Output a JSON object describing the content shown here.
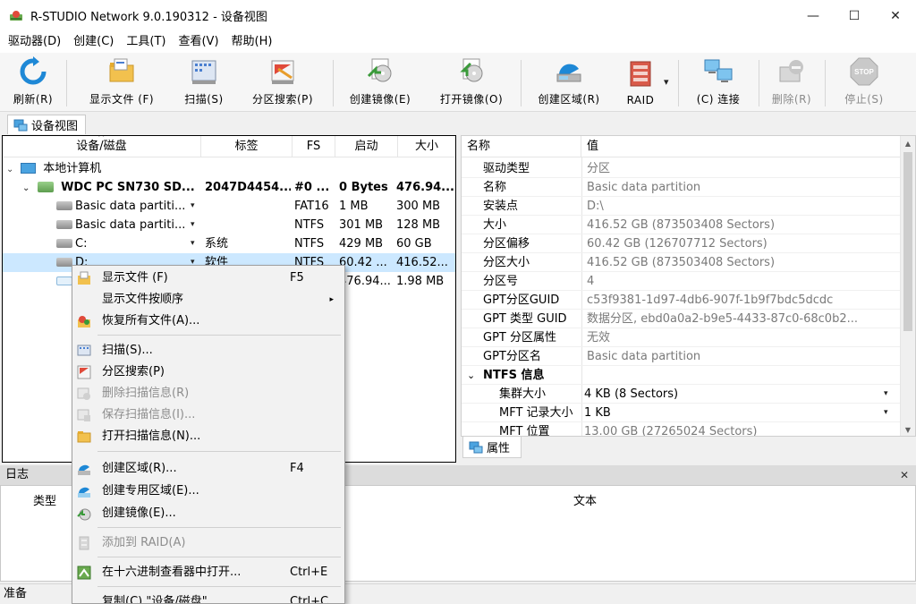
{
  "window": {
    "title": "R-STUDIO Network 9.0.190312 - 设备视图",
    "min_glyph": "—",
    "max_glyph": "☐",
    "close_glyph": "✕"
  },
  "menu": [
    "驱动器(D)",
    "创建(C)",
    "工具(T)",
    "查看(V)",
    "帮助(H)"
  ],
  "toolbar": {
    "refresh": "刷新(R)",
    "show_files": "显示文件 (F)",
    "scan": "扫描(S)",
    "partition_search": "分区搜索(P)",
    "create_image": "创建镜像(E)",
    "open_image": "打开镜像(O)",
    "create_region": "创建区域(R)",
    "raid": "RAID",
    "connect": "(C) 连接",
    "delete": "删除(R)",
    "stop": "停止(S)",
    "stop_icon_text": "STOP",
    "raid_dropdown_glyph": "▾"
  },
  "tab": {
    "device_view": "设备视图"
  },
  "tree": {
    "columns": [
      "设备/磁盘",
      "标签",
      "FS",
      "启动",
      "大小"
    ],
    "sort_glyph": "^",
    "expand_glyph": "⌄",
    "dropdown_glyph": "▾",
    "root": "本地计算机",
    "disk": {
      "name": "WDC PC SN730 SD...",
      "label": "2047D4454...",
      "fs": "#0 ...",
      "start": "0 Bytes",
      "size": "476.94..."
    },
    "rows": [
      {
        "name": "Basic data partiti...",
        "label": "",
        "fs": "FAT16",
        "start": "1 MB",
        "size": "300 MB"
      },
      {
        "name": "Basic data partiti...",
        "label": "",
        "fs": "NTFS",
        "start": "301 MB",
        "size": "128 MB"
      },
      {
        "name": "C:",
        "label": "系统",
        "fs": "NTFS",
        "start": "429 MB",
        "size": "60 GB"
      },
      {
        "name": "D:",
        "label": "软件",
        "fs": "NTFS",
        "start": "60.42 ...",
        "size": "416.52..."
      },
      {
        "name": "",
        "label": "",
        "fs": "",
        "start": "476.94...",
        "size": "1.98 MB"
      }
    ]
  },
  "properties": {
    "columns": [
      "名称",
      "值"
    ],
    "collapse_glyph": "⌄",
    "dropdown_glyph": "▾",
    "rows": [
      {
        "name": "驱动类型",
        "value": "分区"
      },
      {
        "name": "名称",
        "value": "Basic data partition"
      },
      {
        "name": "安装点",
        "value": "D:\\"
      },
      {
        "name": "大小",
        "value": "416.52 GB (873503408 Sectors)"
      },
      {
        "name": "分区偏移",
        "value": "60.42 GB (126707712 Sectors)"
      },
      {
        "name": "分区大小",
        "value": "416.52 GB (873503408 Sectors)"
      },
      {
        "name": "分区号",
        "value": "4"
      },
      {
        "name": "GPT分区GUID",
        "value": "c53f9381-1d97-4db6-907f-1b9f7bdc5dcdc"
      },
      {
        "name": "GPT 类型 GUID",
        "value": "数据分区, ebd0a0a2-b9e5-4433-87c0-68c0b2..."
      },
      {
        "name": "GPT 分区属性",
        "value": "无效"
      },
      {
        "name": "GPT分区名",
        "value": "Basic data partition"
      }
    ],
    "section": "NTFS 信息",
    "sub_rows": [
      {
        "name": "集群大小",
        "value": "4 KB (8 Sectors)"
      },
      {
        "name": "MFT 记录大小",
        "value": "1 KB"
      },
      {
        "name": "MFT 位置",
        "value": "13.00 GB (27265024 Sectors)"
      }
    ],
    "tab": "属性",
    "scroll_up": "▲",
    "scroll_down": "▼"
  },
  "log": {
    "title": "日志",
    "close_glyph": "✕",
    "col_type": "类型",
    "col_text": "文本"
  },
  "status": "准备",
  "context_menu": {
    "submenu_glyph": "▸",
    "items": [
      {
        "label": "显示文件 (F)",
        "shortcut": "F5"
      },
      {
        "label": "显示文件按顺序",
        "shortcut": ""
      },
      {
        "label": "恢复所有文件(A)...",
        "shortcut": ""
      },
      {
        "label": "扫描(S)...",
        "shortcut": ""
      },
      {
        "label": "分区搜索(P)",
        "shortcut": ""
      },
      {
        "label": "删除扫描信息(R)",
        "shortcut": ""
      },
      {
        "label": "保存扫描信息(I)...",
        "shortcut": ""
      },
      {
        "label": "打开扫描信息(N)...",
        "shortcut": ""
      },
      {
        "label": "创建区域(R)...",
        "shortcut": "F4"
      },
      {
        "label": "创建专用区域(E)...",
        "shortcut": ""
      },
      {
        "label": "创建镜像(E)...",
        "shortcut": ""
      },
      {
        "label": "添加到 RAID(A)",
        "shortcut": ""
      },
      {
        "label": "在十六进制查看器中打开...",
        "shortcut": "Ctrl+E"
      },
      {
        "label": "复制(C) \"设备/磁盘\"",
        "shortcut": "Ctrl+C"
      }
    ]
  },
  "colors": {
    "selection": "#cce8ff",
    "accent_blue": "#1e88d6",
    "disabled_text": "#8d8d8d"
  }
}
